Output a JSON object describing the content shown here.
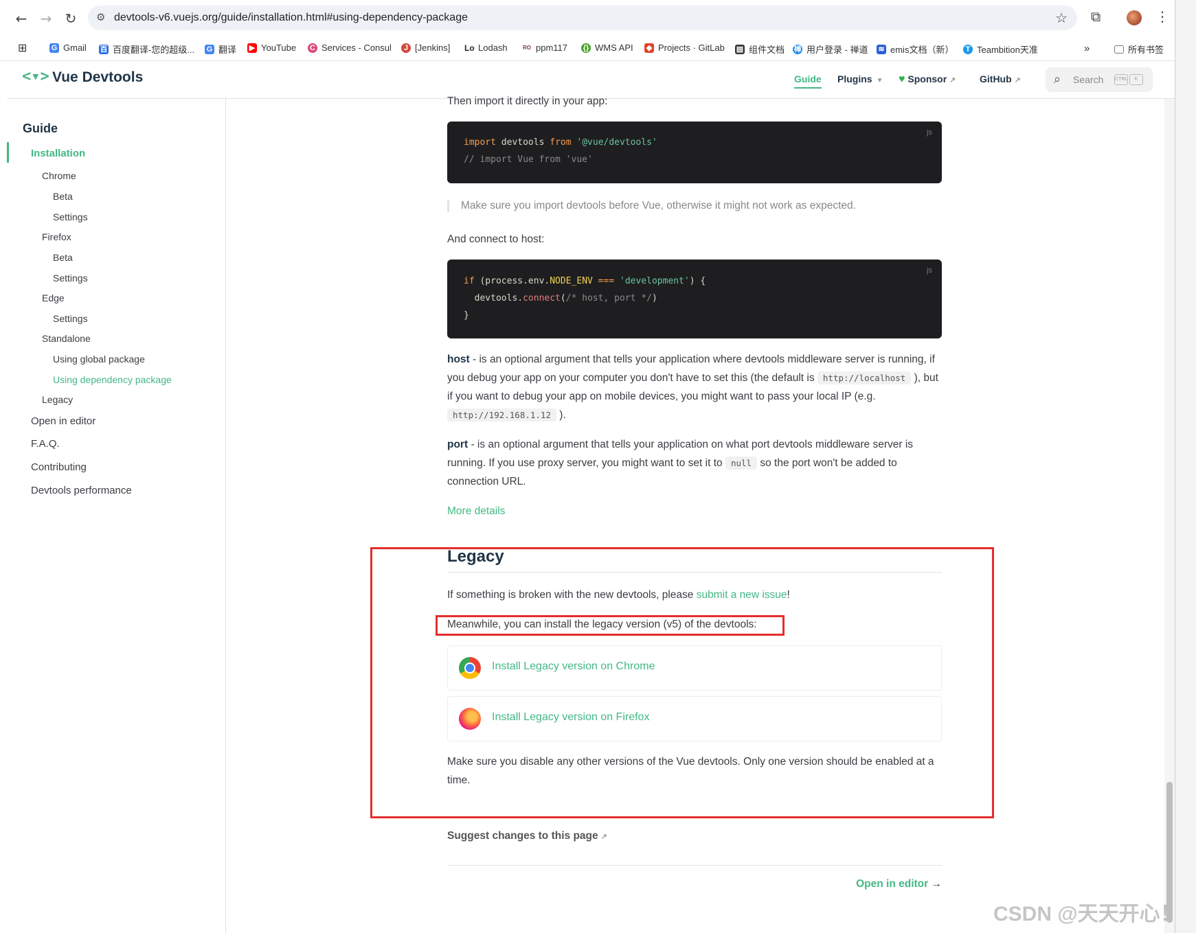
{
  "browser": {
    "url": "devtools-v6.vuejs.org/guide/installation.html#using-dependency-package",
    "bookmarks": [
      {
        "label": "Gmail",
        "icon": "google-icon",
        "color": "#4285f4"
      },
      {
        "label": "百度翻译-您的超级...",
        "icon": "baidu-translate-icon",
        "color": "#2b6de5"
      },
      {
        "label": "翻译",
        "icon": "google-translate-icon",
        "color": "#4285f4"
      },
      {
        "label": "YouTube",
        "icon": "youtube-icon",
        "color": "#ff0000"
      },
      {
        "label": "Services - Consul",
        "icon": "consul-icon",
        "color": "#dc477d"
      },
      {
        "label": "[Jenkins]",
        "icon": "jenkins-icon",
        "color": "#d24939"
      },
      {
        "label": "Lodash",
        "icon": "lodash-icon",
        "color": "#222222"
      },
      {
        "label": "ppm117",
        "icon": "robo-icon",
        "color": "#7a3a3a"
      },
      {
        "label": "WMS API",
        "icon": "swagger-icon",
        "color": "#49a32b"
      },
      {
        "label": "Projects · GitLab",
        "icon": "gitlab-icon",
        "color": "#e24329"
      },
      {
        "label": "组件文档",
        "icon": "doc-icon",
        "color": "#333333"
      },
      {
        "label": "用户登录 - 禅道",
        "icon": "zentao-icon",
        "color": "#1e88e5"
      },
      {
        "label": "emis文档（新）",
        "icon": "layers-icon",
        "color": "#2a5fd8"
      },
      {
        "label": "Teambition天准",
        "icon": "teambition-icon",
        "color": "#1b9aee"
      }
    ],
    "bookmarks_folder": "所有书签"
  },
  "site": {
    "brand": "Vue Devtools",
    "nav": {
      "guide": "Guide",
      "plugins": "Plugins",
      "sponsor": "Sponsor",
      "github": "GitHub"
    },
    "search": {
      "label": "Search",
      "key1": "CTRL",
      "key2": "K"
    }
  },
  "sidebar": {
    "heading": "Guide",
    "items": [
      {
        "label": "Installation"
      },
      {
        "label": "Chrome"
      },
      {
        "label": "Beta"
      },
      {
        "label": "Settings"
      },
      {
        "label": "Firefox"
      },
      {
        "label": "Beta"
      },
      {
        "label": "Settings"
      },
      {
        "label": "Edge"
      },
      {
        "label": "Settings"
      },
      {
        "label": "Standalone"
      },
      {
        "label": "Using global package"
      },
      {
        "label": "Using dependency package"
      },
      {
        "label": "Legacy"
      },
      {
        "label": "Open in editor"
      },
      {
        "label": "F.A.Q."
      },
      {
        "label": "Contributing"
      },
      {
        "label": "Devtools performance"
      }
    ]
  },
  "content": {
    "import_intro": "Then import it directly in your app:",
    "code1": {
      "lang": "js",
      "l1_kw1": "import",
      "l1_id": " devtools ",
      "l1_kw2": "from",
      "l1_str": " '@vue/devtools'",
      "l2": "// import Vue from 'vue'"
    },
    "note": "Make sure you import devtools before Vue, otherwise it might not work as expected.",
    "connect_intro": "And connect to host:",
    "code2": {
      "lang": "js",
      "l1_if": "if",
      "l1_a": " (process.env.",
      "l1_env": "NODE_ENV",
      "l1_op": " ===",
      "l1_str": " 'development'",
      "l1_b": ") {",
      "l2_a": "  devtools.",
      "l2_fn": "connect",
      "l2_b": "(",
      "l2_cm": "/* host, port */",
      "l2_c": ")",
      "l3": "}"
    },
    "host": {
      "term": "host",
      "t1": " - is an optional argument that tells your application where devtools middleware server is running, if you debug your app on your computer you don't have to set this (the default is ",
      "code1": "http://localhost",
      "t2": " ), but if you want to debug your app on mobile devices, you might want to pass your local IP (e.g. ",
      "code2": "http://192.168.1.12",
      "t3": " )."
    },
    "port": {
      "term": "port",
      "t1": " - is an optional argument that tells your application on what port devtools middleware server is running. If you use proxy server, you might want to set it to ",
      "code": "null",
      "t2": " so the port won't be added to connection URL."
    },
    "more_details": "More details",
    "legacy": {
      "heading": "Legacy",
      "p1_a": "If something is broken with the new devtools, please ",
      "p1_link": "submit a new issue",
      "p1_b": "!",
      "p2": "Meanwhile, you can install the legacy version (v5) of the devtools:",
      "chrome_btn": "Install Legacy version on Chrome",
      "firefox_btn": "Install Legacy version on Firefox",
      "p3": "Make sure you disable any other versions of the Vue devtools. Only one version should be enabled at a time."
    },
    "suggest": "Suggest changes to this page",
    "open_in_editor": "Open in editor"
  },
  "watermark": "CSDN @天天开心！",
  "colors": {
    "accent": "#42b883",
    "highlight_box": "#e52d2d"
  }
}
